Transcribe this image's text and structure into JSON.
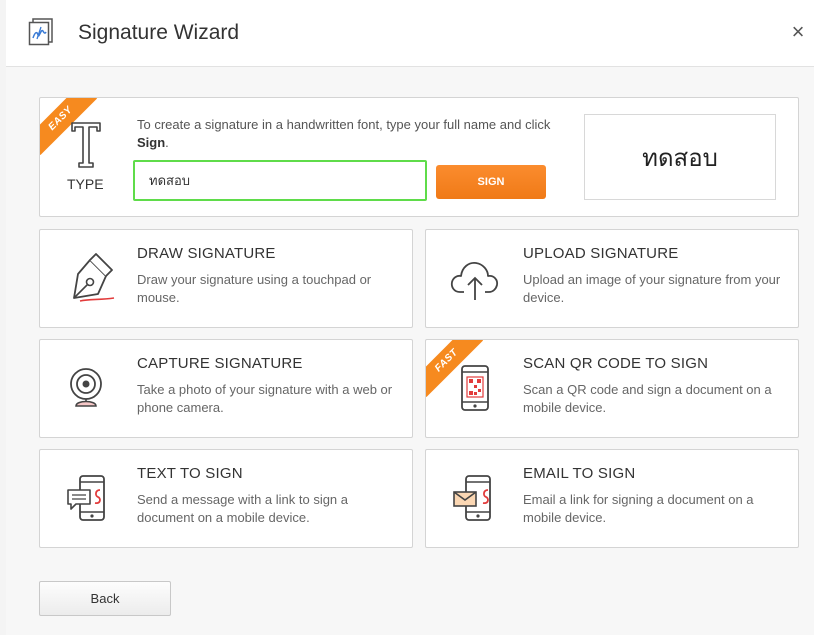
{
  "dialog": {
    "title": "Signature Wizard",
    "close_label": "×"
  },
  "type_card": {
    "ribbon": "EASY",
    "icon_glyph": "T",
    "label": "TYPE",
    "description_start": "To create a signature in a handwritten font, type your full name and click ",
    "description_bold": "Sign",
    "description_end": ".",
    "input_value": "ทดสอบ",
    "sign_label": "SIGN",
    "preview_text": "ทดสอบ"
  },
  "options": {
    "draw": {
      "title": "DRAW SIGNATURE",
      "description": "Draw your signature using a touchpad or mouse.",
      "icon": "pen-nib-icon"
    },
    "upload": {
      "title": "UPLOAD SIGNATURE",
      "description": "Upload an image of your signature from your device.",
      "icon": "cloud-upload-icon"
    },
    "capture": {
      "title": "CAPTURE SIGNATURE",
      "description": "Take a photo of your signature with a web or phone camera.",
      "icon": "webcam-icon"
    },
    "scan": {
      "ribbon": "FAST",
      "title": "SCAN QR CODE TO SIGN",
      "description": "Scan a QR code and sign a document on a mobile device.",
      "icon": "qr-phone-icon"
    },
    "text": {
      "title": "TEXT TO SIGN",
      "description": "Send a message with a link to sign a document on a mobile device.",
      "icon": "sms-phone-icon"
    },
    "email": {
      "title": "EMAIL TO SIGN",
      "description": "Email a link for signing a document on a mobile device.",
      "icon": "email-phone-icon"
    }
  },
  "footer": {
    "back_label": "Back"
  },
  "colors": {
    "accent_orange": "#f68a1f",
    "input_focus_green": "#5fdc4a",
    "signature_red": "#e23b3b"
  }
}
